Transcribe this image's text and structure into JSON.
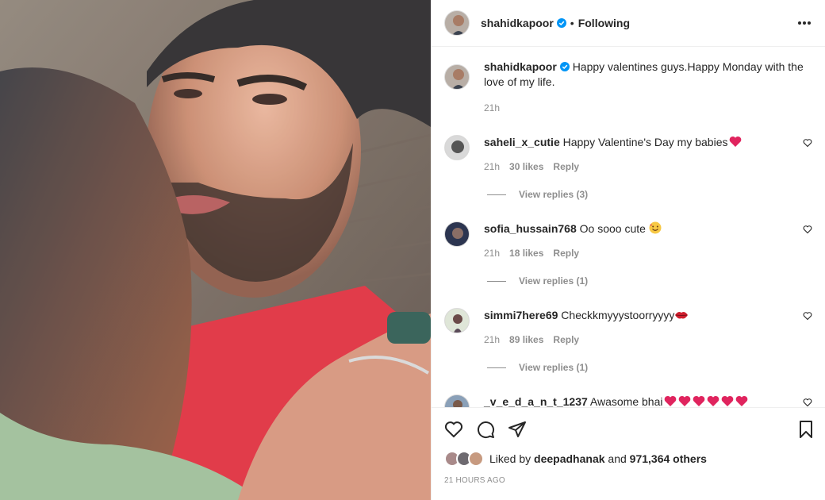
{
  "header": {
    "username": "shahidkapoor",
    "separator": "•",
    "follow_status": "Following"
  },
  "caption": {
    "username": "shahidkapoor",
    "text": "Happy valentines guys.Happy Monday with the love of my life.",
    "time": "21h"
  },
  "comments": [
    {
      "username": "saheli_x_cutie",
      "text": "Happy Valentine's Day my babies",
      "time": "21h",
      "likes": "30 likes",
      "reply": "Reply",
      "view_replies": "View replies (3)",
      "emoji": "red-heart"
    },
    {
      "username": "sofia_hussain768",
      "text": "Oo sooo cute",
      "time": "21h",
      "likes": "18 likes",
      "reply": "Reply",
      "view_replies": "View replies (1)",
      "emoji": "smiling-face-with-hearts"
    },
    {
      "username": "simmi7here69",
      "text": "Checkkmyyystoorryyyy",
      "time": "21h",
      "likes": "89 likes",
      "reply": "Reply",
      "view_replies": "View replies (1)",
      "emoji": "kiss-mark"
    },
    {
      "username": "_v_e_d_a_n_t_1237",
      "text": "Awasome bhai",
      "emoji": "red-heart x6"
    }
  ],
  "actions": {
    "liked_prefix": "Liked by",
    "liked_user": "deepadhanak",
    "liked_and": "and",
    "liked_count": "971,364 others",
    "timestamp": "21 HOURS AGO"
  },
  "icons": {
    "verified": "verified-badge-icon",
    "more": "more-options-icon",
    "like": "heart-outline-icon",
    "comment": "comment-bubble-icon",
    "share": "paper-plane-icon",
    "save": "bookmark-icon"
  },
  "colors": {
    "verified_blue": "#0095f6",
    "text": "#262626",
    "muted": "#8e8e8e",
    "heart_red": "#e0245e",
    "border": "#efefef"
  }
}
